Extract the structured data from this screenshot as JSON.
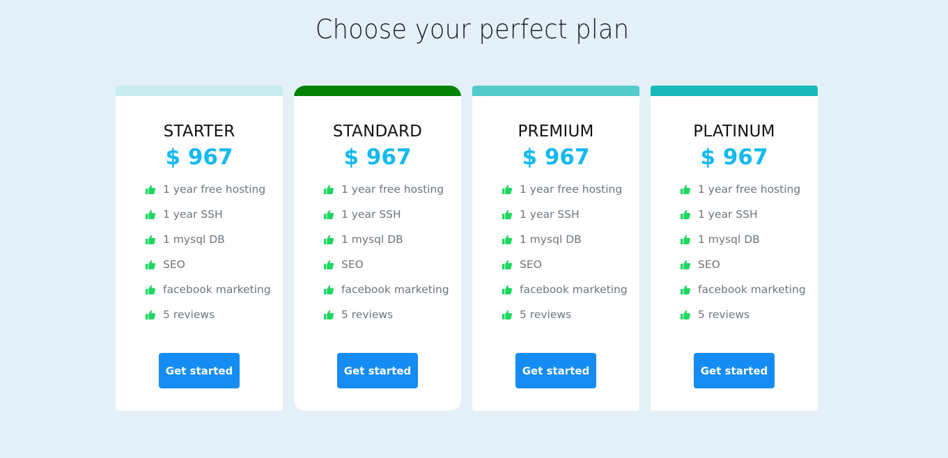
{
  "header": {
    "title": "Choose your perfect plan"
  },
  "colors": {
    "background": "#e3f0f7",
    "price": "#14b9ee",
    "button": "#148cf3",
    "thumb": "#1ed760"
  },
  "plans": [
    {
      "name": "STARTER",
      "price": "$ 967",
      "accent": "#c7ecef",
      "features": [
        "1 year free hosting",
        "1 year SSH",
        "1 mysql DB",
        "SEO",
        "facebook marketing",
        "5 reviews"
      ],
      "button": "Get started"
    },
    {
      "name": "STANDARD",
      "price": "$ 967",
      "accent": "#07820a",
      "features": [
        "1 year free hosting",
        "1 year SSH",
        "1 mysql DB",
        "SEO",
        "facebook marketing",
        "5 reviews"
      ],
      "button": "Get started"
    },
    {
      "name": "PREMIUM",
      "price": "$ 967",
      "accent": "#55cbcb",
      "features": [
        "1 year free hosting",
        "1 year SSH",
        "1 mysql DB",
        "SEO",
        "facebook marketing",
        "5 reviews"
      ],
      "button": "Get started"
    },
    {
      "name": "PLATINUM",
      "price": "$ 967",
      "accent": "#18b9b9",
      "features": [
        "1 year free hosting",
        "1 year SSH",
        "1 mysql DB",
        "SEO",
        "facebook marketing",
        "5 reviews"
      ],
      "button": "Get started"
    }
  ]
}
